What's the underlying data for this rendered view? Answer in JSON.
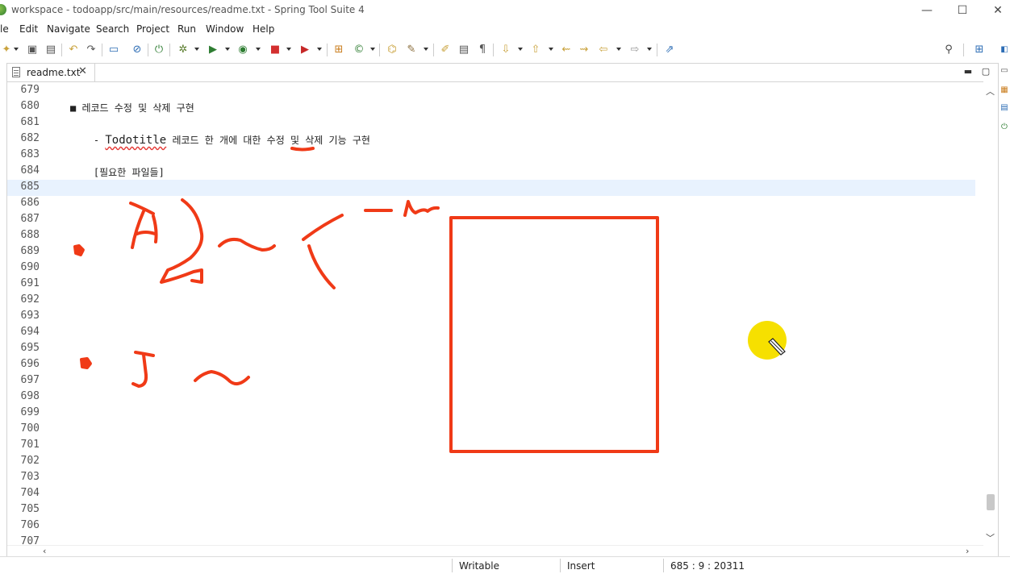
{
  "window": {
    "title": "workspace - todoapp/src/main/resources/readme.txt - Spring Tool Suite 4",
    "minimize": "—",
    "maximize": "☐",
    "close": "✕"
  },
  "menu": {
    "items": [
      "le",
      "Edit",
      "Navigate",
      "Search",
      "Project",
      "Run",
      "Window",
      "Help"
    ]
  },
  "toolbar": {
    "icons": [
      "new-icon",
      "save-icon",
      "save-all-icon",
      "undo-icon",
      "redo-icon",
      "terminal-icon",
      "skip-breakpoints-icon",
      "spring-boot-icon",
      "debug-icon",
      "run-icon",
      "coverage-icon",
      "stop-icon",
      "external-tools-icon",
      "new-package-icon",
      "new-class-icon",
      "open-type-icon",
      "open-task-icon",
      "toggle-mark-occurrences-icon",
      "show-whitespace-icon",
      "paragraph-icon",
      "next-annotation-icon",
      "previous-annotation-icon",
      "last-edit-icon",
      "next-edit-icon",
      "back-icon",
      "forward-icon",
      "pin-editor-icon",
      "search-icon",
      "open-perspective-icon"
    ]
  },
  "editor": {
    "tab_label": "readme.txt",
    "tab_close": "✕",
    "minimize": "▬",
    "maximize": "▢",
    "current_line": "685",
    "lines": [
      {
        "num": "679",
        "text": ""
      },
      {
        "num": "680",
        "text": "■ 레코드 수정 및 삭제 구현"
      },
      {
        "num": "681",
        "text": ""
      },
      {
        "num": "682",
        "pre": "    - ",
        "word": "Todotitle",
        "post": " 레코드 한 개에 대한 수정 및 삭제 기능 구현"
      },
      {
        "num": "683",
        "text": ""
      },
      {
        "num": "684",
        "text": "    [필요한 파일들]"
      },
      {
        "num": "685",
        "text": ""
      },
      {
        "num": "686",
        "text": ""
      },
      {
        "num": "687",
        "text": ""
      },
      {
        "num": "688",
        "text": ""
      },
      {
        "num": "689",
        "text": ""
      },
      {
        "num": "690",
        "text": ""
      },
      {
        "num": "691",
        "text": ""
      },
      {
        "num": "692",
        "text": ""
      },
      {
        "num": "693",
        "text": ""
      },
      {
        "num": "694",
        "text": ""
      },
      {
        "num": "695",
        "text": ""
      },
      {
        "num": "696",
        "text": ""
      },
      {
        "num": "697",
        "text": ""
      },
      {
        "num": "698",
        "text": ""
      },
      {
        "num": "699",
        "text": ""
      },
      {
        "num": "700",
        "text": ""
      },
      {
        "num": "701",
        "text": ""
      },
      {
        "num": "702",
        "text": ""
      },
      {
        "num": "703",
        "text": ""
      },
      {
        "num": "704",
        "text": ""
      },
      {
        "num": "705",
        "text": ""
      },
      {
        "num": "706",
        "text": ""
      },
      {
        "num": "707",
        "text": ""
      }
    ]
  },
  "status": {
    "writable": "Writable",
    "insert_mode": "Insert",
    "position": "685 : 9 : 20311"
  },
  "colors": {
    "annotation_red": "#f03a17",
    "cursor_highlight": "#f6e000",
    "current_line_bg": "#e8f2fe"
  }
}
